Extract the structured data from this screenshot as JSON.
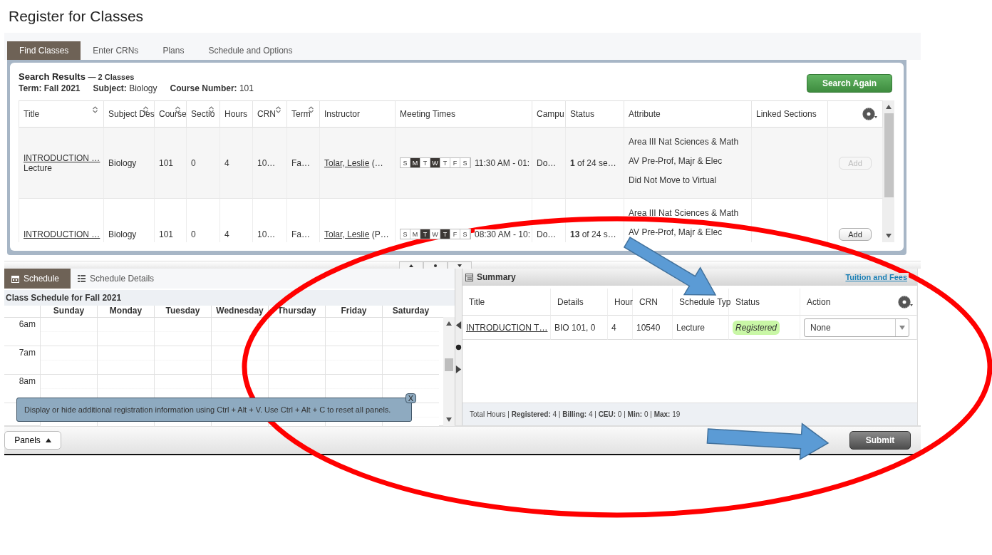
{
  "page_title": "Register for Classes",
  "tabs": [
    {
      "label": "Find Classes",
      "selected": true
    },
    {
      "label": "Enter CRNs",
      "selected": false
    },
    {
      "label": "Plans",
      "selected": false
    },
    {
      "label": "Schedule and Options",
      "selected": false
    }
  ],
  "search_results": {
    "heading": "Search Results",
    "count": "— 2 Classes",
    "criteria": [
      "**Term: Fall 2021**",
      "**Subject:** Biology",
      "**Course Number:** 101"
    ],
    "search_button": "Search Again",
    "columns": [
      {
        "label": "Title",
        "sortable": true
      },
      {
        "label": "Subject Des",
        "sortable": true
      },
      {
        "label": "Course",
        "sortable": true
      },
      {
        "label": "Sectio",
        "sortable": true
      },
      {
        "label": "Hours",
        "sortable": false
      },
      {
        "label": "CRN",
        "sortable": true
      },
      {
        "label": "Term",
        "sortable": true
      },
      {
        "label": "Instructor",
        "sortable": false
      },
      {
        "label": "Meeting Times",
        "sortable": false
      },
      {
        "label": "Campu",
        "sortable": false
      },
      {
        "label": "Status",
        "sortable": false
      },
      {
        "label": "Attribute",
        "sortable": false
      },
      {
        "label": "Linked Sections",
        "sortable": false
      }
    ],
    "rows": [
      {
        "title": "INTRODUCTION …",
        "type": "Lecture",
        "subject": "Biology",
        "course": "101",
        "section": "0",
        "hours": "4",
        "crn": "10…",
        "term": "Fa…",
        "instructor": "Tolar, Leslie",
        "instructor_extra": "(…",
        "days": [
          {
            "label": "S",
            "on": false
          },
          {
            "label": "M",
            "on": true
          },
          {
            "label": "T",
            "on": false
          },
          {
            "label": "W",
            "on": true
          },
          {
            "label": "T",
            "on": false
          },
          {
            "label": "F",
            "on": false
          },
          {
            "label": "S",
            "on": false
          }
        ],
        "time": "11:30 AM - 01:",
        "campus": "Do…",
        "status": "**1** of 24 se…",
        "attributes": [
          "Area III Nat Sciences & Math",
          "AV Pre-Prof, Majr & Elec",
          "Did Not Move to Virtual"
        ],
        "add": {
          "label": "Add",
          "disabled": true
        }
      },
      {
        "title": "INTRODUCTION …",
        "subject": "Biology",
        "course": "101",
        "section": "0",
        "hours": "4",
        "crn": "10…",
        "term": "Fa…",
        "instructor": "Tolar, Leslie",
        "instructor_extra": "(P…",
        "days": [
          {
            "label": "S",
            "on": false
          },
          {
            "label": "M",
            "on": false
          },
          {
            "label": "T",
            "on": true
          },
          {
            "label": "W",
            "on": false
          },
          {
            "label": "T",
            "on": true
          },
          {
            "label": "F",
            "on": false
          },
          {
            "label": "S",
            "on": false
          }
        ],
        "time": "08:30 AM - 10:",
        "campus": "Do…",
        "status": "**13** of 24 s…",
        "attributes": [
          "Area III Nat Sciences & Math",
          "AV Pre-Prof, Majr & Elec"
        ],
        "add": {
          "label": "Add",
          "disabled": false
        }
      }
    ]
  },
  "schedule_panel": {
    "tabs": [
      {
        "label": "Schedule",
        "kind": "calendar",
        "selected": true
      },
      {
        "label": "Schedule Details",
        "kind": "list",
        "selected": false
      }
    ],
    "title": "Class Schedule for Fall 2021",
    "days": [
      "Sunday",
      "Monday",
      "Tuesday",
      "Wednesday",
      "Thursday",
      "Friday",
      "Saturday"
    ],
    "hours": [
      "6am",
      "7am",
      "8am"
    ],
    "tip": {
      "text": "Display or hide additional registration information using Ctrl + Alt + V. Use Ctrl + Alt + C to reset all panels.",
      "close": "X"
    }
  },
  "summary": {
    "title": "Summary",
    "link": "Tuition and Fees",
    "columns": [
      "Title",
      "Details",
      "Hour",
      "CRN",
      "Schedule Typ",
      "Status",
      "Action"
    ],
    "rows": [
      {
        "title": "INTRODUCTION T…",
        "details": "BIO 101, 0",
        "hours": "4",
        "crn": "10540",
        "type": "Lecture",
        "status": "Registered",
        "action": "None"
      }
    ],
    "totals": "Total Hours | **Registered:** 4 | **Billing:** 4 | **CEU:** 0 | **Min:** 0 | **Max:** 19"
  },
  "footer": {
    "panels": "Panels",
    "submit": "Submit"
  },
  "annotations": [
    {
      "kind": "ellipse"
    },
    {
      "kind": "arrow"
    },
    {
      "kind": "arrow"
    }
  ]
}
